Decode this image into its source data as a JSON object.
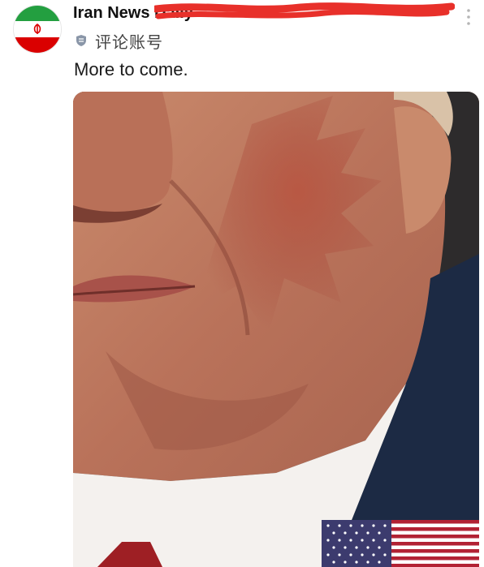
{
  "post": {
    "author_name": "Iran News Daily",
    "badge_label": "评论账号",
    "text": "More to come.",
    "avatar_icon": "iran-flag-avatar",
    "badge_icon": "shield-icon",
    "more_icon": "more-vertical-icon",
    "photo_alt": "Close-up photo of a face with a red hand-print on the cheek",
    "photo_flag_icon": "us-flag-icon",
    "colors": {
      "green": "#239f40",
      "red": "#da0000",
      "redaction": "#e8302a"
    }
  }
}
